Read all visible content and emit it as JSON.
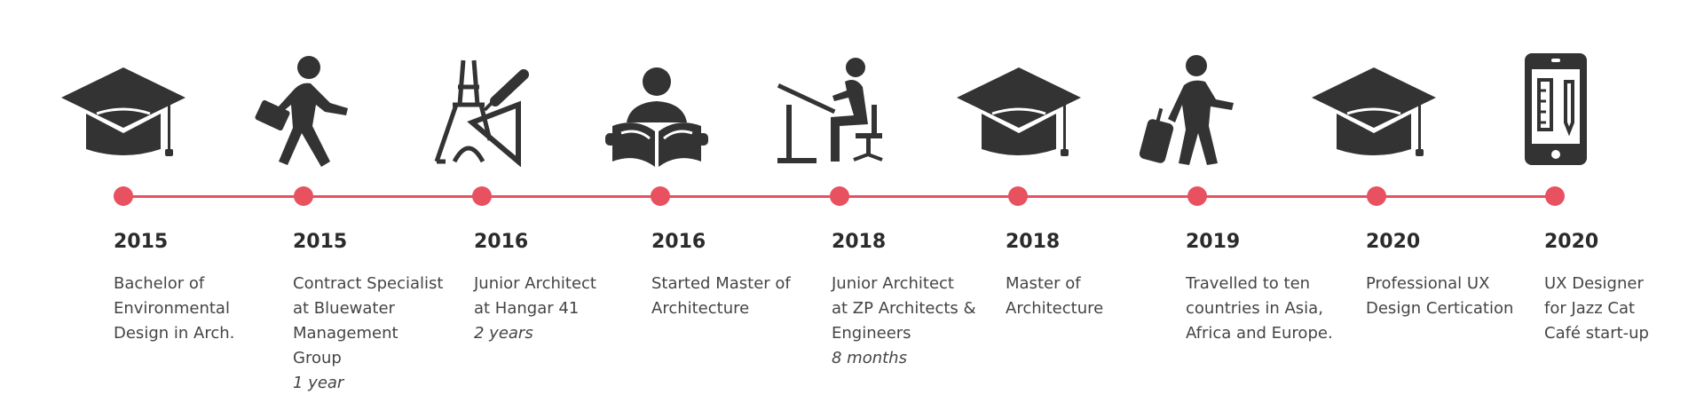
{
  "accent_color": "#e8515f",
  "icon_color": "#333333",
  "items": [
    {
      "year": "2015",
      "icon": "graduation-cap-icon",
      "lines": [
        "Bachelor of",
        "Environmental",
        "Design in Arch."
      ],
      "note": ""
    },
    {
      "year": "2015",
      "icon": "walking-businessman-icon",
      "lines": [
        "Contract Specialist",
        "at Bluewater",
        "Management",
        "Group"
      ],
      "note": "1 year"
    },
    {
      "year": "2016",
      "icon": "eiffel-tower-drafting-icon",
      "lines": [
        "Junior Architect",
        "at Hangar 41"
      ],
      "note": "2 years"
    },
    {
      "year": "2016",
      "icon": "reading-student-icon",
      "lines": [
        "Started Master of",
        "Architecture"
      ],
      "note": ""
    },
    {
      "year": "2018",
      "icon": "architect-at-drafting-table-icon",
      "lines": [
        "Junior Architect",
        "at ZP Architects &",
        "Engineers"
      ],
      "note": "8 months"
    },
    {
      "year": "2018",
      "icon": "graduation-cap-icon",
      "lines": [
        "Master of",
        "Architecture"
      ],
      "note": ""
    },
    {
      "year": "2019",
      "icon": "traveler-with-suitcase-icon",
      "lines": [
        "Travelled to ten",
        "countries in Asia,",
        "Africa and Europe."
      ],
      "note": ""
    },
    {
      "year": "2020",
      "icon": "graduation-cap-icon",
      "lines": [
        "Professional UX",
        "Design Certication"
      ],
      "note": ""
    },
    {
      "year": "2020",
      "icon": "tablet-design-icon",
      "lines": [
        "UX Designer",
        "for Jazz Cat",
        "Café start-up"
      ],
      "note": ""
    }
  ]
}
